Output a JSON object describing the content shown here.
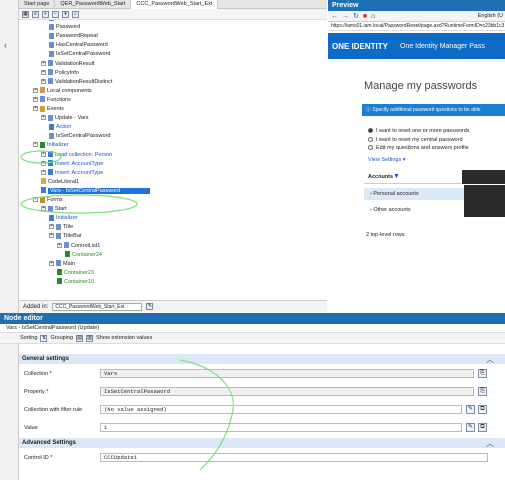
{
  "tabs": [
    "Start page",
    "QER_PasswordWeb_Start",
    "CCC_PasswordWeb_Start_Ext"
  ],
  "tree": [
    {
      "label": "Vars",
      "cls": ""
    },
    {
      "label": "Password",
      "cls": ""
    },
    {
      "label": "PasswordRepeat",
      "cls": ""
    },
    {
      "label": "HasCentralPassword",
      "cls": ""
    },
    {
      "label": "IsSetCentralPassword",
      "cls": ""
    },
    {
      "label": "ValidationResult",
      "cls": ""
    },
    {
      "label": "PolicyInfo",
      "cls": ""
    },
    {
      "label": "ValidationResultDistinct",
      "cls": ""
    },
    {
      "label": "Local components",
      "cls": ""
    },
    {
      "label": "Functions",
      "cls": ""
    },
    {
      "label": "Events",
      "cls": ""
    },
    {
      "label": "Update - Vars",
      "cls": ""
    },
    {
      "label": "Action",
      "cls": "blue"
    },
    {
      "label": "IsSetCentralPassword",
      "cls": ""
    },
    {
      "label": "Initializer",
      "cls": "blue"
    },
    {
      "label": "Load collection: Person",
      "cls": "blue"
    },
    {
      "label": "Insert: AccountType",
      "cls": "blue"
    },
    {
      "label": "Insert: AccountType",
      "cls": "blue"
    },
    {
      "label": "CodeLiteral1",
      "cls": ""
    },
    {
      "label": "Vars - IsSetCentralPassword",
      "cls": "sel"
    },
    {
      "label": "Forms",
      "cls": ""
    },
    {
      "label": "Start",
      "cls": ""
    },
    {
      "label": "Initializer",
      "cls": "blue"
    },
    {
      "label": "Title",
      "cls": ""
    },
    {
      "label": "TitleBar",
      "cls": ""
    },
    {
      "label": "ControlList1",
      "cls": ""
    },
    {
      "label": "Container24",
      "cls": "green"
    },
    {
      "label": "Main",
      "cls": ""
    },
    {
      "label": "Container23",
      "cls": "green"
    },
    {
      "label": "Container10",
      "cls": "green"
    }
  ],
  "added_in": {
    "label": "Added in:",
    "value": "CCC_PasswordWeb_Start_Ext"
  },
  "preview": {
    "title": "Preview",
    "lang": "English (U",
    "url": "https://iams01.iam.local/PasswordReset/page.axd?RuntimeFormID=c23bb1c3",
    "brand": "ONE IDENTITY",
    "product": "One Identity Manager Pass",
    "heading": "Manage my passwords",
    "info": "Specify additional password questions to be able",
    "options": [
      "I want to reset one or more passwords",
      "I want to reset my central password",
      "Edit my questions and answers profile"
    ],
    "view_settings": "View Settings ▾",
    "accounts": "Accounts",
    "personal": "›  Personal accounts",
    "other": "›  Other accounts",
    "rows": "2 top-level rows"
  },
  "node_editor": {
    "title": "Node editor",
    "subtitle": "Vars - IsSetCentralPassword (Update)",
    "sorting": "Sorting",
    "grouping": "Grouping",
    "show_ext": "Show extension values",
    "general": "General settings",
    "collection_label": "Collection *",
    "collection_value": "Vars",
    "property_label": "Property *",
    "property_value": "IsSetCentralPassword",
    "filter_label": "Collection with filter rule",
    "filter_value": "(No value assigned)",
    "value_label": "Value",
    "value_value": "1",
    "advanced": "Advanced Settings",
    "control_label": "Control ID *",
    "control_value": "CCCUpdate1"
  },
  "colors": {
    "accent": "#1f6fb5",
    "selection": "#1e73d6",
    "annotation": "#7fe07f"
  }
}
